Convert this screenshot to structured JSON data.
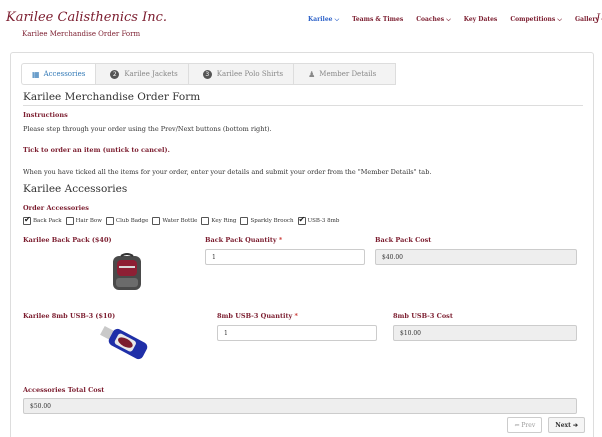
{
  "header": {
    "brand": "Karilee Calisthenics Inc.",
    "subtitle": "Karilee Merchandise Order Form",
    "nav": [
      {
        "label": "Karilee",
        "caret": "⌵",
        "active": true
      },
      {
        "label": "Teams & Times",
        "caret": "",
        "active": false
      },
      {
        "label": "Coaches",
        "caret": "⌵",
        "active": false
      },
      {
        "label": "Key Dates",
        "caret": "",
        "active": false
      },
      {
        "label": "Competitions",
        "caret": "⌵",
        "active": false
      },
      {
        "label": "Gallery",
        "caret": "⌵",
        "active": false
      }
    ],
    "nav_tail": "J"
  },
  "tabs": [
    {
      "label": "Accessories",
      "icon": "grid-icon",
      "glyph": "▦",
      "active": true
    },
    {
      "label": "Karilee Jackets",
      "num": "2"
    },
    {
      "label": "Karilee Polo Shirts",
      "num": "3"
    },
    {
      "label": "Member Details",
      "icon": "user-icon",
      "glyph": "♟"
    }
  ],
  "form": {
    "title": "Karilee Merchandise Order Form",
    "instructions_label": "Instructions",
    "instructions_text": "Please step through your order using the Prev/Next buttons (bottom right).",
    "tick_text": "Tick to order an item (untick to cancel).",
    "when_text": "When you have ticked all the items for your order, enter your details and submit your order from the \"Member Details\" tab.",
    "accessories_title": "Karilee Accessories",
    "order_label": "Order Accessories",
    "items": [
      {
        "label": "Back Pack",
        "checked": true
      },
      {
        "label": "Hair Bow",
        "checked": false
      },
      {
        "label": "Club Badge",
        "checked": false
      },
      {
        "label": "Water Bottle",
        "checked": false
      },
      {
        "label": "Key Ring",
        "checked": false
      },
      {
        "label": "Sparkly Brooch",
        "checked": false
      },
      {
        "label": "USB-3 8mb",
        "checked": true
      }
    ],
    "backpack": {
      "title": "Karilee Back Pack ($40)",
      "qty_label": "Back Pack Quantity",
      "qty_value": "1",
      "cost_label": "Back Pack Cost",
      "cost_value": "$40.00"
    },
    "usb": {
      "title": "Karilee 8mb USB-3 ($10)",
      "qty_label": "8mb USB-3 Quantity",
      "qty_value": "1",
      "cost_label": "8mb USB-3 Cost",
      "cost_value": "$10.00"
    },
    "total_label": "Accessories Total Cost",
    "total_value": "$50.00",
    "required_mark": "*"
  },
  "pager": {
    "prev_label": "⇐ Prev",
    "next_label": "Next ➔"
  },
  "colors": {
    "brand": "#7b1c2e",
    "nav_active": "#2f63c9",
    "link": "#337ab7"
  }
}
